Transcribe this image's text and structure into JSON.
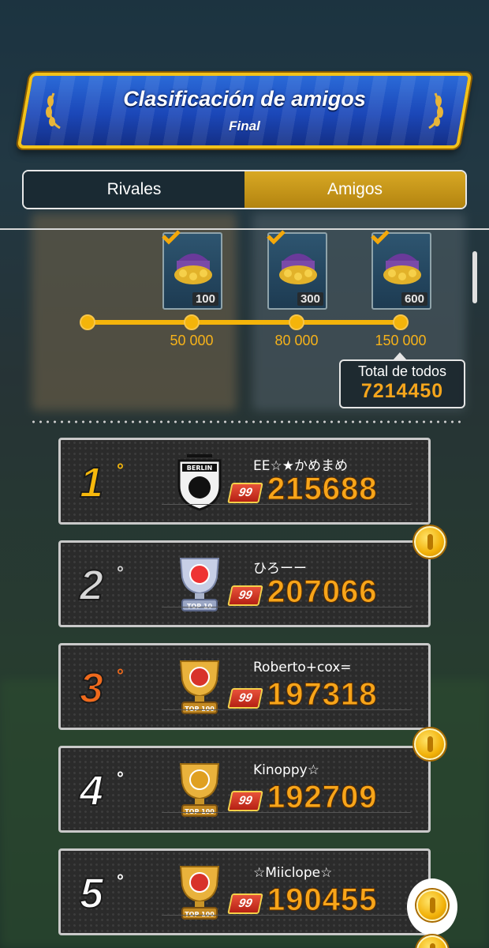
{
  "header": {
    "title": "Clasificación de amigos",
    "subtitle": "Final"
  },
  "tabs": [
    {
      "label": "Rivales",
      "active": false
    },
    {
      "label": "Amigos",
      "active": true
    }
  ],
  "rewards": [
    {
      "amount": "100",
      "threshold": "50 000",
      "claimed": true
    },
    {
      "amount": "300",
      "threshold": "80 000",
      "claimed": true
    },
    {
      "amount": "600",
      "threshold": "150 000",
      "claimed": true
    }
  ],
  "total": {
    "label": "Total de todos",
    "value": "7214450"
  },
  "ranking": [
    {
      "rank": "1",
      "ordinal": "°",
      "name": "EE☆★かめまめ",
      "level": "99",
      "score": "215688",
      "rank_color": "#f6b80c",
      "emblem": "berlin-crest-icon"
    },
    {
      "rank": "2",
      "ordinal": "°",
      "name": "ひろーー",
      "level": "99",
      "score": "207066",
      "rank_color": "#d6d6d6",
      "emblem": "silver-top10-trophy-icon"
    },
    {
      "rank": "3",
      "ordinal": "°",
      "name": "Roberto+cox=",
      "level": "99",
      "score": "197318",
      "rank_color": "#f06a1c",
      "emblem": "gold-top100-trophy-icon"
    },
    {
      "rank": "4",
      "ordinal": "°",
      "name": "Kinoppy☆",
      "level": "99",
      "score": "192709",
      "rank_color": "#ffffff",
      "emblem": "gold-top100-trophy-icon"
    },
    {
      "rank": "5",
      "ordinal": "°",
      "name": "☆Miiclope☆",
      "level": "99",
      "score": "190455",
      "rank_color": "#ffffff",
      "emblem": "gold-top100-trophy-icon"
    }
  ],
  "colors": {
    "accent_gold": "#f4b40a",
    "score_orange": "#f7a51a",
    "banner_blue": "#1b47b8"
  }
}
